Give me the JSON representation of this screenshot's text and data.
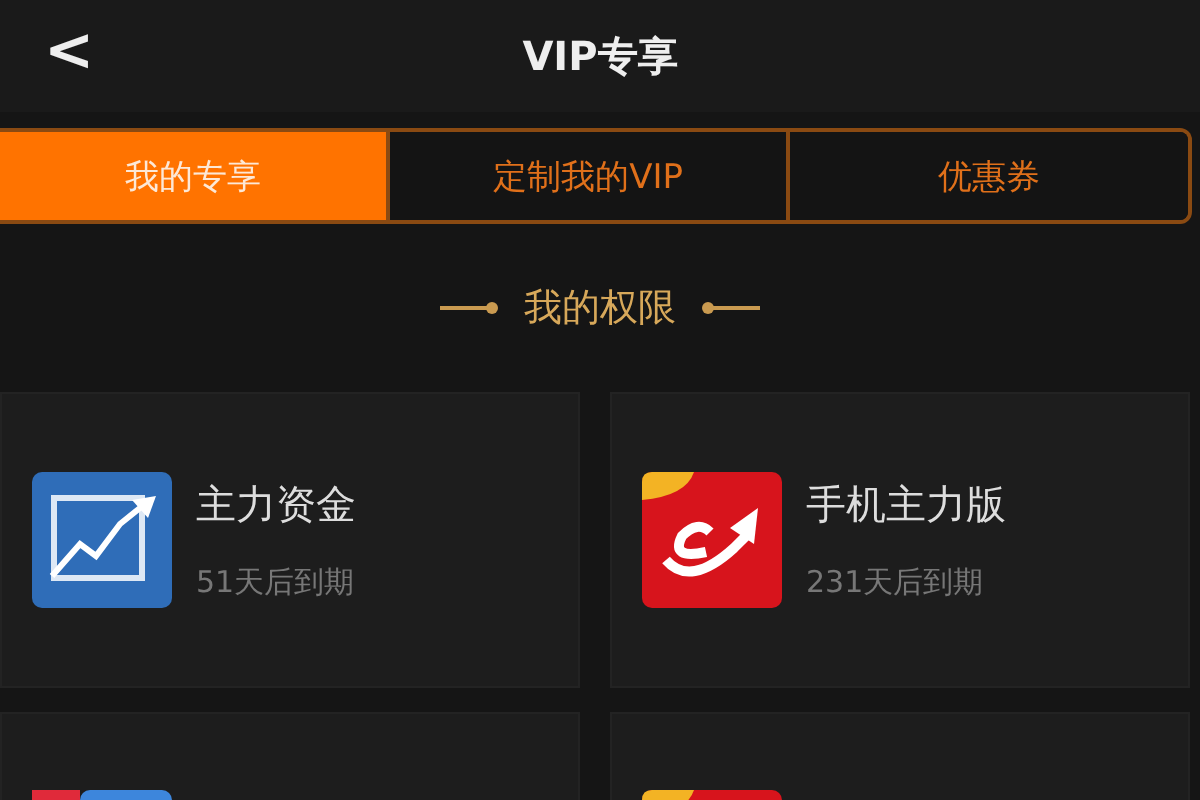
{
  "header": {
    "back": "<",
    "title": "VIP专享"
  },
  "tabs": [
    {
      "label": "我的专享",
      "selected": true
    },
    {
      "label": "定制我的VIP",
      "selected": false
    },
    {
      "label": "优惠券",
      "selected": false
    }
  ],
  "section_title": "我的权限",
  "privileges": [
    {
      "kind": "chart",
      "name": "主力资金",
      "expiry": "51天后到期"
    },
    {
      "kind": "logo",
      "name": "手机主力版",
      "expiry": "231天后到期"
    },
    {
      "kind": "split"
    },
    {
      "kind": "badge"
    }
  ]
}
